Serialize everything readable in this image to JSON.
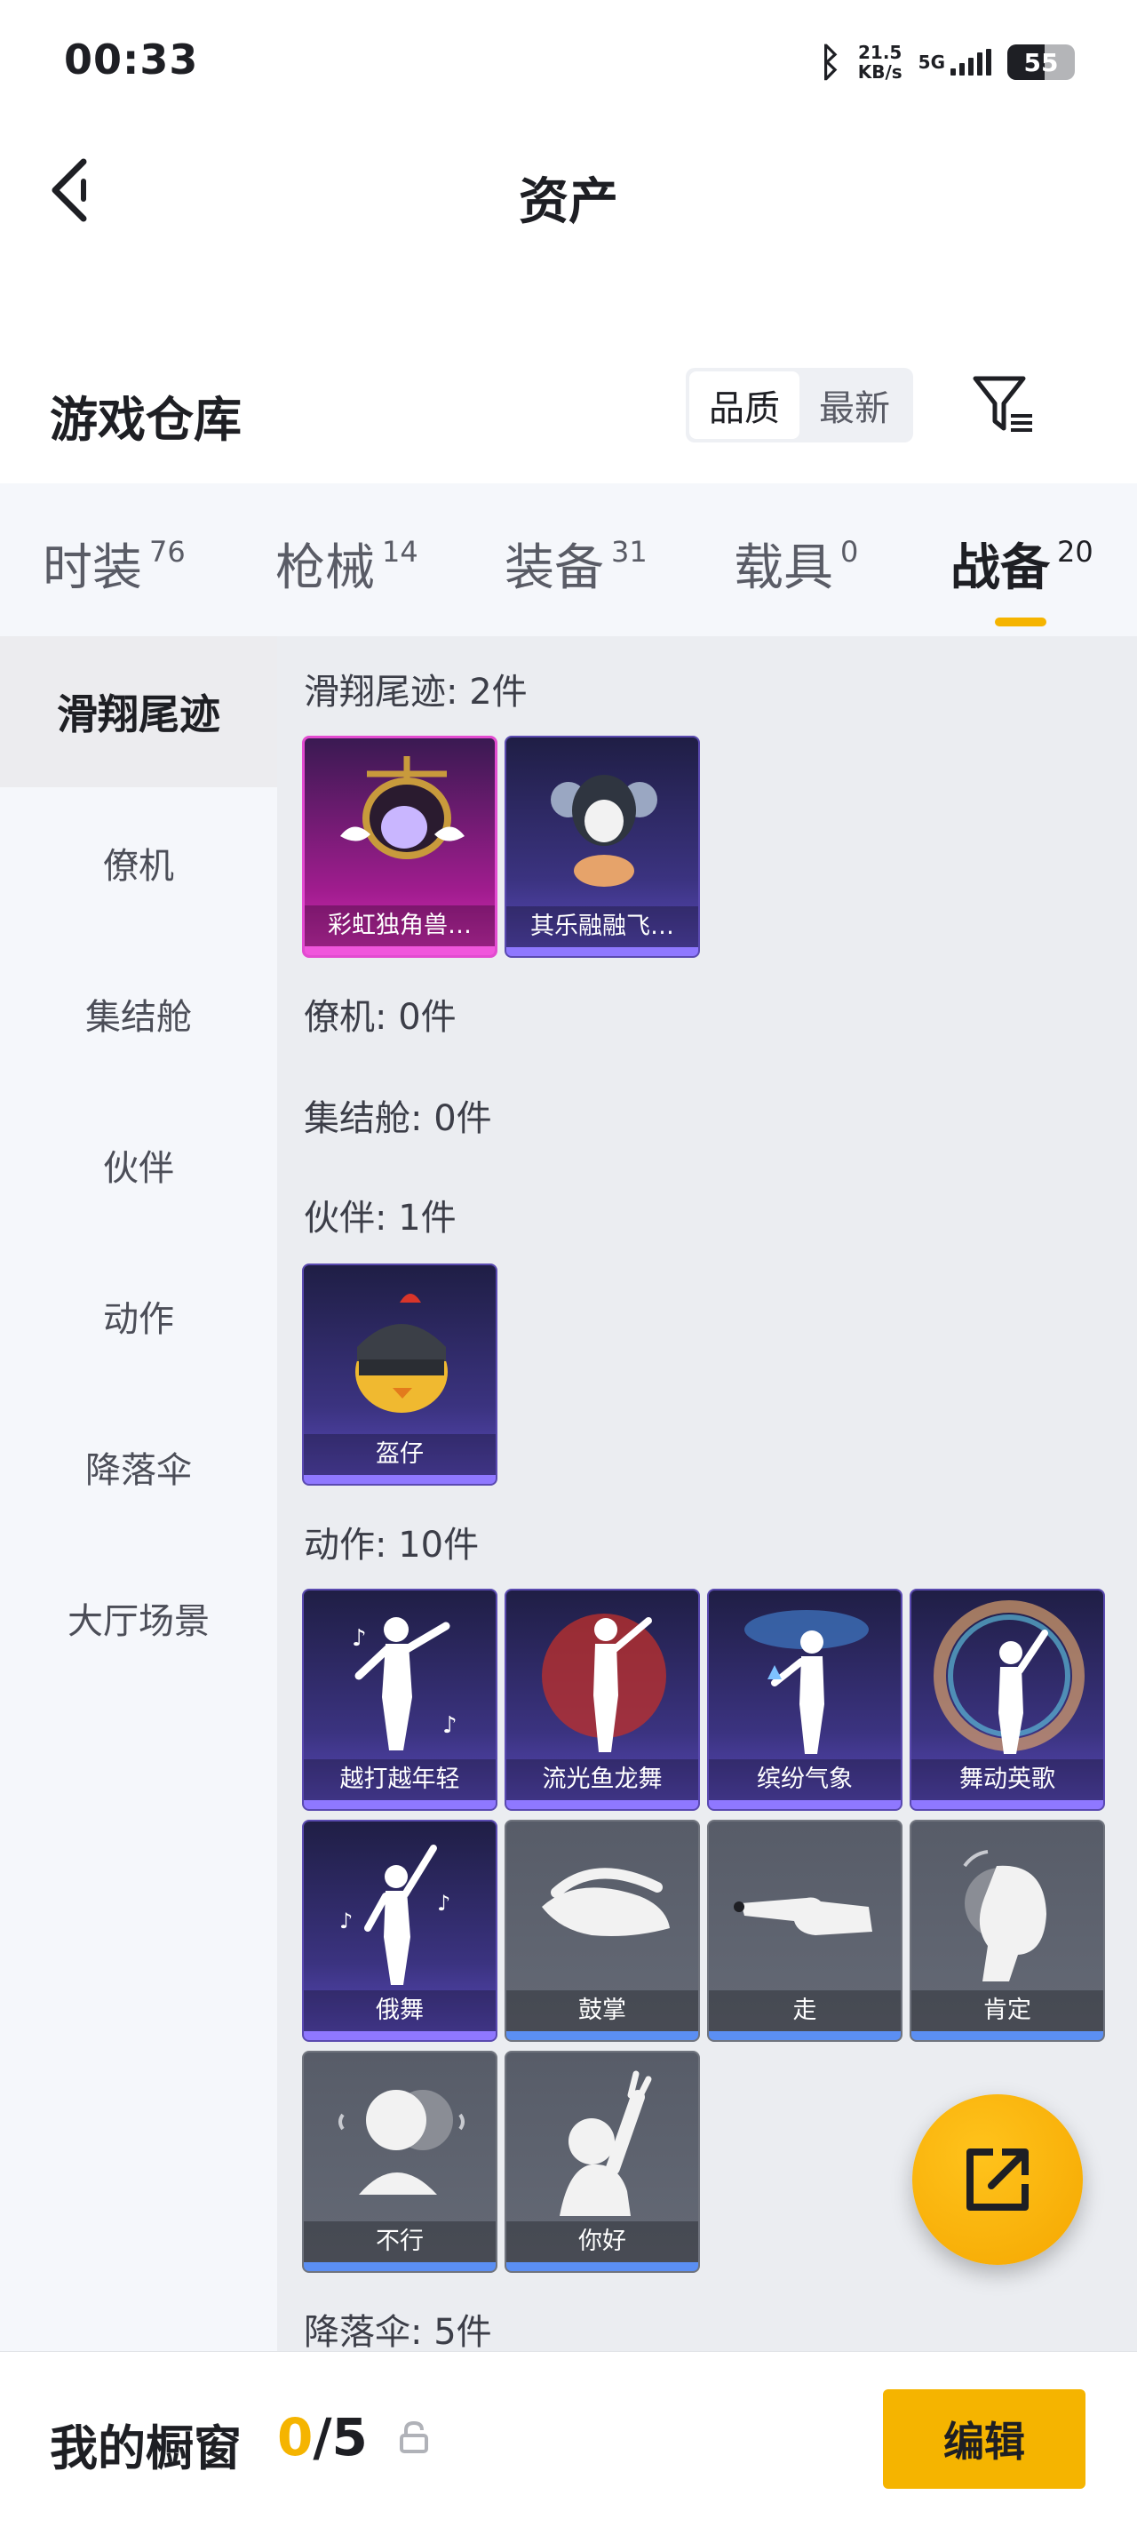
{
  "status_bar": {
    "time": "00:33",
    "net_speed_value": "21.5",
    "net_speed_unit": "KB/s",
    "network": "5G",
    "battery": "55",
    "battery_level": 0.55
  },
  "header": {
    "title": "资产"
  },
  "warehouse": {
    "title": "游戏仓库",
    "sort_options": [
      "品质",
      "最新"
    ],
    "selected_sort": "品质"
  },
  "tabs": [
    {
      "label": "时装",
      "count": "76"
    },
    {
      "label": "枪械",
      "count": "14"
    },
    {
      "label": "装备",
      "count": "31"
    },
    {
      "label": "载具",
      "count": "0"
    },
    {
      "label": "战备",
      "count": "20"
    }
  ],
  "active_tab": "战备",
  "sidebar": {
    "items": [
      "滑翔尾迹",
      "僚机",
      "集结舱",
      "伙伴",
      "动作",
      "降落伞",
      "大厅场景"
    ],
    "active": "滑翔尾迹"
  },
  "sections": {
    "glide": {
      "title": "滑翔尾迹: 2件",
      "items": [
        "彩虹独角兽…",
        "其乐融融飞…"
      ]
    },
    "wingman": {
      "title": "僚机: 0件"
    },
    "pod": {
      "title": "集结舱: 0件"
    },
    "partner": {
      "title": "伙伴: 1件",
      "items": [
        "盔仔"
      ]
    },
    "action": {
      "title": "动作: 10件",
      "items": [
        "越打越年轻",
        "流光鱼龙舞",
        "缤纷气象",
        "舞动英歌",
        "俄舞",
        "鼓掌",
        "走",
        "肯定",
        "不行",
        "你好"
      ]
    },
    "parachute": {
      "title": "降落伞: 5件"
    }
  },
  "bottom": {
    "showcase_label": "我的橱窗",
    "count_current": "0",
    "count_sep": "/",
    "count_total": "5",
    "edit_label": "编辑"
  },
  "colors": {
    "accent": "#f5b400",
    "rarity_pink": "#d62fb7",
    "rarity_purple": "#5b4bbf",
    "rarity_grey": "#656a76"
  }
}
